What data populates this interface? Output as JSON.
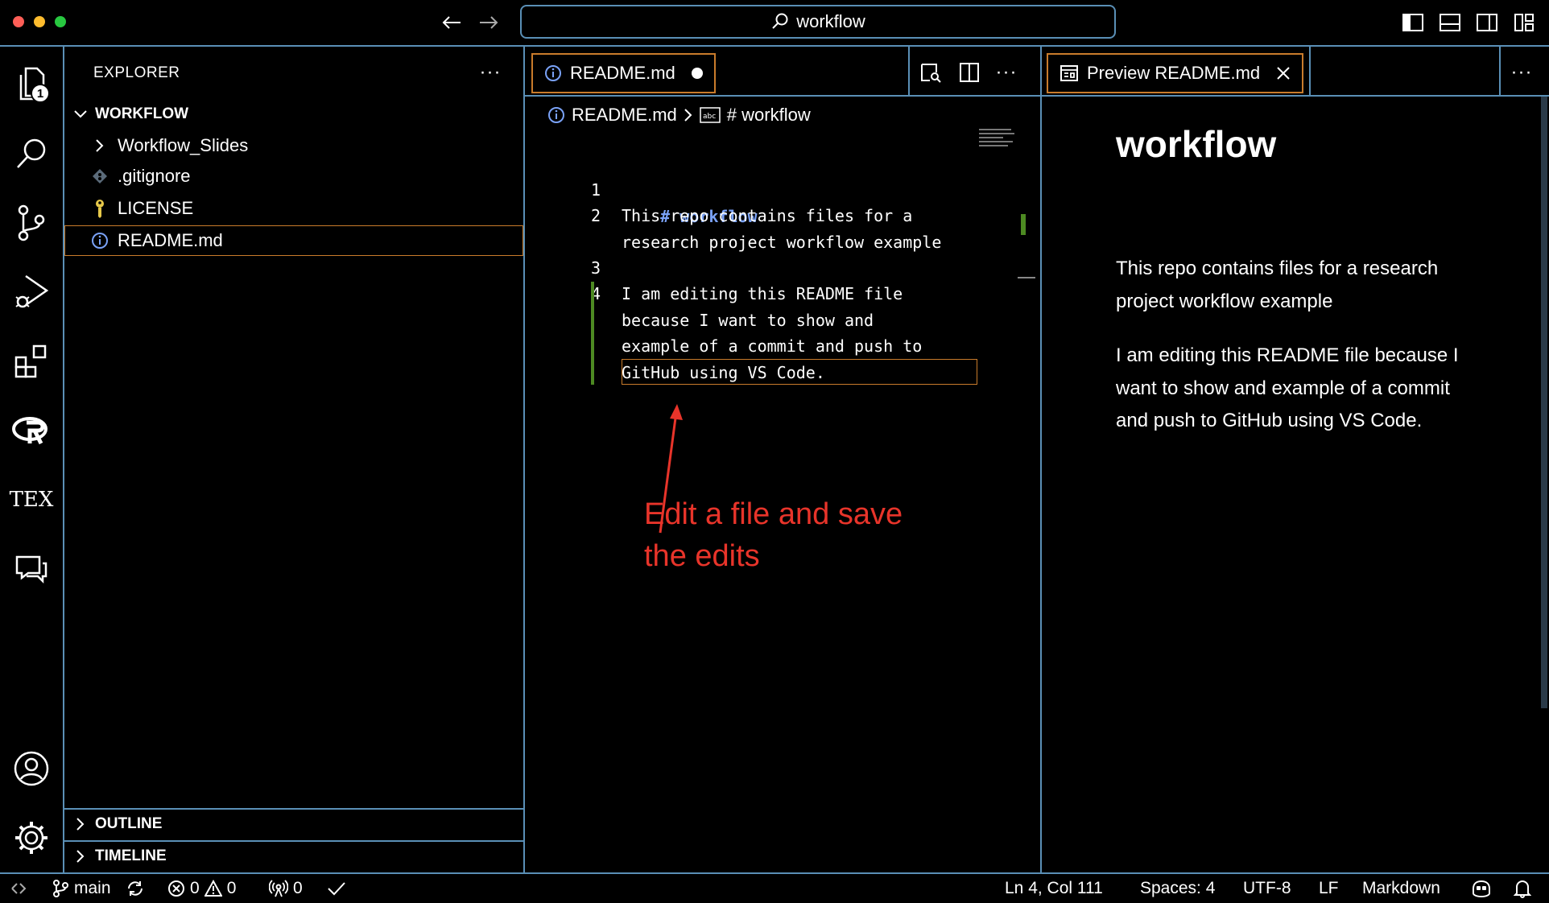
{
  "titlebar": {
    "search_text": "workflow",
    "traffic_colors": [
      "#ff5f57",
      "#febc2e",
      "#28c840"
    ]
  },
  "activity": {
    "explorer_badge": "1",
    "tex_label": "TEX"
  },
  "sidebar": {
    "title": "EXPLORER",
    "more": "···",
    "folder": "WORKFLOW",
    "items": [
      {
        "label": "Workflow_Slides",
        "icon": "chevron-right-icon"
      },
      {
        "label": ".gitignore",
        "icon": "git-icon"
      },
      {
        "label": "LICENSE",
        "icon": "key-icon"
      },
      {
        "label": "README.md",
        "icon": "info-icon"
      }
    ],
    "outline": "OUTLINE",
    "timeline": "TIMELINE"
  },
  "editor": {
    "tab_label": "README.md",
    "more": "···",
    "breadcrumb": {
      "file": "README.md",
      "symbol": "# workflow"
    },
    "lines": [
      {
        "num": "1",
        "text": "# workflow"
      },
      {
        "num": "2",
        "text": "This repo contains files for a\nresearch project workflow example"
      },
      {
        "num": "3",
        "text": ""
      },
      {
        "num": "4",
        "text": "I am editing this README file\nbecause I want to show and\nexample of a commit and push to\nGitHub using VS Code."
      }
    ],
    "annotation": "Edit a file and save\nthe edits",
    "annotation_color": "#e8342a",
    "heading_color": "#7aa2f7"
  },
  "preview": {
    "tab_label": "Preview README.md",
    "more": "···",
    "title": "workflow",
    "paragraphs": [
      "This repo contains files for a research project workflow example",
      "I am editing this README file because I want to show and example of a commit and push to GitHub using VS Code."
    ]
  },
  "status": {
    "branch": "main",
    "errors": "0",
    "warnings": "0",
    "ports": "0",
    "position": "Ln 4, Col 111",
    "spaces": "Spaces: 4",
    "encoding": "UTF-8",
    "eol": "LF",
    "language": "Markdown"
  }
}
